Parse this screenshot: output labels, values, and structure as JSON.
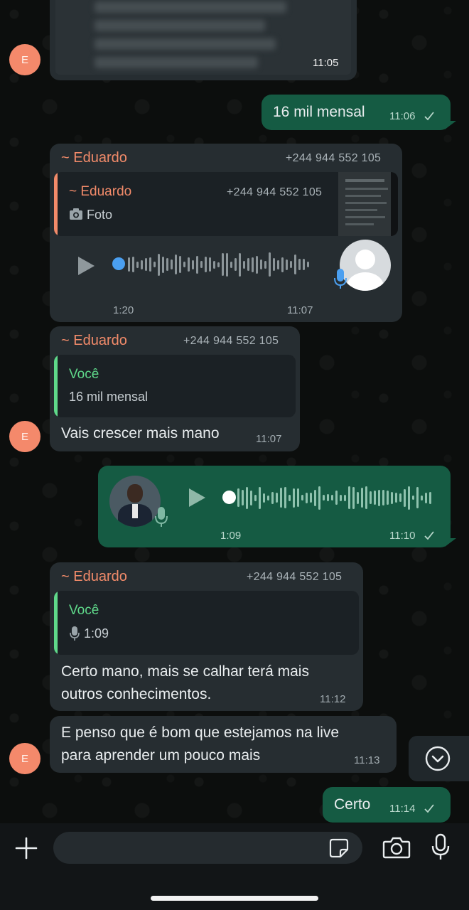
{
  "messages": {
    "m1": {
      "time": "11:05"
    },
    "m2": {
      "text": "16 mil mensal",
      "time": "11:06"
    },
    "m3": {
      "sender": "~ Eduardo",
      "phone": "+244 944 552 105",
      "quote_sender": "~ Eduardo",
      "quote_phone": "+244 944 552 105",
      "quote_text": "Foto",
      "duration": "1:20",
      "time": "11:07"
    },
    "m4": {
      "sender": "~ Eduardo",
      "phone": "+244 944 552 105",
      "quote_sender": "Você",
      "quote_text": "16 mil mensal",
      "text": "Vais crescer mais mano",
      "time": "11:07"
    },
    "m5": {
      "duration": "1:09",
      "time": "11:10"
    },
    "m6": {
      "sender": "~ Eduardo",
      "phone": "+244 944 552 105",
      "quote_sender": "Você",
      "quote_text": "1:09",
      "text_line1": "Certo mano, mais se calhar terá mais",
      "text_line2": "outros conhecimentos.",
      "time": "11:12"
    },
    "m7": {
      "text_line1": "E penso que é bom que estejamos na live",
      "text_line2": "para aprender um pouco mais",
      "time": "11:13"
    },
    "m8": {
      "text": "Certo",
      "time": "11:14"
    }
  },
  "avatar_initial": "E",
  "colors": {
    "sender": "#f28b6a",
    "you": "#5fd98a",
    "outgoing_bubble": "#155b43",
    "incoming_bubble": "#262d31",
    "mic_blue": "#4a9ff0"
  },
  "icons": [
    "plus-icon",
    "sticker-icon",
    "camera-icon",
    "mic-icon",
    "scroll-down-icon",
    "play-icon",
    "checkmark-icon"
  ]
}
